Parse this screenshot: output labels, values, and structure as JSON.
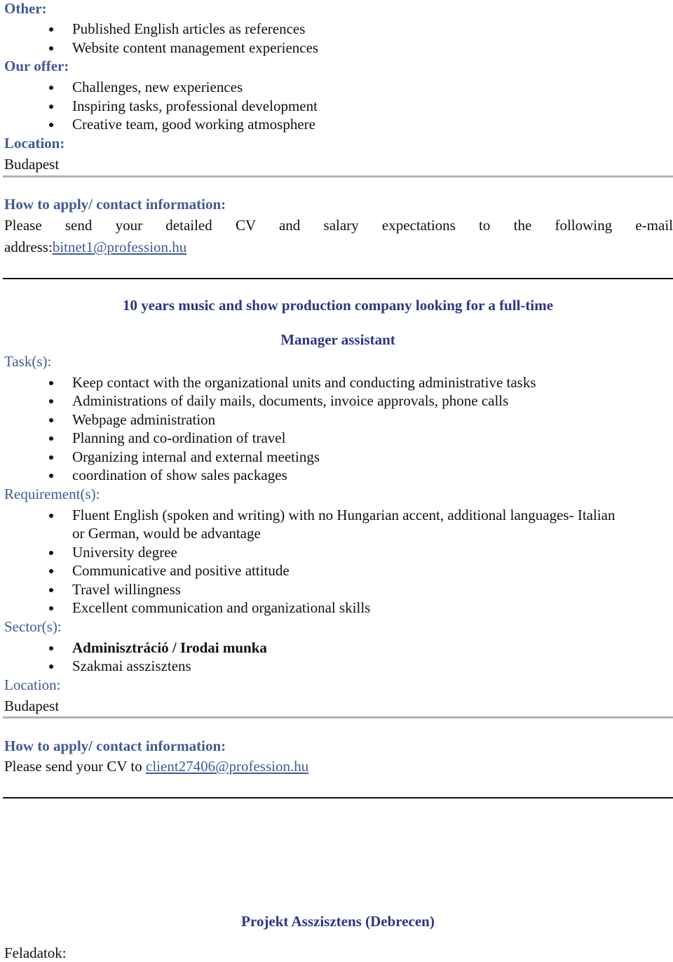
{
  "section1": {
    "other_heading": "Other:",
    "other_items": [
      "Published English articles as references",
      "Website content management experiences"
    ],
    "offer_heading": "Our offer:",
    "offer_items": [
      "Challenges, new experiences",
      "Inspiring tasks, professional development",
      "Creative team, good working atmosphere"
    ],
    "location_heading": "Location:",
    "location_value": "Budapest",
    "apply_heading": "How to apply/ contact information:",
    "apply_text_line1": "Please send your detailed CV and salary expectations to the following e-mail",
    "apply_text_prefix": "address:",
    "apply_email": "bitnet1@profession.hu"
  },
  "job2": {
    "title_line1": "10 years music and show production company looking for a full-time",
    "title_line2": "Manager assistant",
    "tasks_heading": "Task(s):",
    "tasks": [
      "Keep contact with the organizational units and conducting administrative tasks",
      "Administrations of daily mails, documents, invoice approvals, phone calls",
      "Webpage administration",
      "Planning and co-ordination of travel",
      "Organizing internal and external meetings",
      "coordination of show sales packages"
    ],
    "requirements_heading": "Requirement(s):",
    "requirements": [
      "Fluent English (spoken and writing) with no Hungarian accent, additional languages- Italian",
      "or German, would be advantage",
      "University degree",
      "Communicative and positive attitude",
      "Travel willingness",
      "Excellent communication and organizational skills"
    ],
    "sectors_heading": "Sector(s):",
    "sectors": [
      "Adminisztráció / Irodai munka",
      "Szakmai asszisztens"
    ],
    "location_heading": "Location:",
    "location_value": "Budapest",
    "apply_heading": "How to apply/ contact information:",
    "apply_text": "Please send your CV to ",
    "apply_email": "client27406@profession.hu"
  },
  "job3": {
    "title": "Projekt Asszisztens (Debrecen)",
    "tasks_label": "Feladatok:"
  }
}
